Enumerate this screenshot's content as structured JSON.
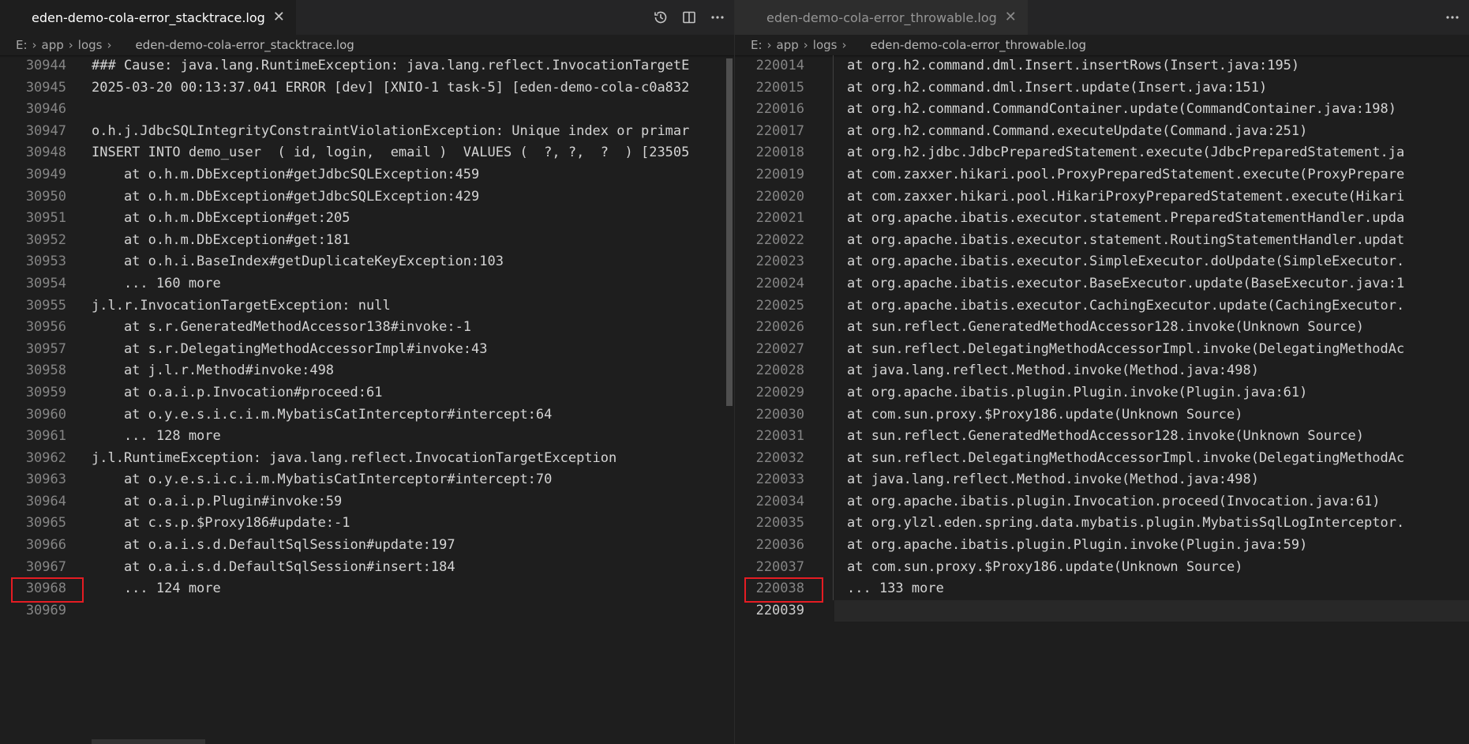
{
  "left": {
    "tab_label": "eden-demo-cola-error_stacktrace.log",
    "breadcrumbs": [
      "E:",
      "app",
      "logs"
    ],
    "breadcrumb_file": "eden-demo-cola-error_stacktrace.log",
    "line_numbers": [
      "30944",
      "30945",
      "30946",
      "30947",
      "30948",
      "30949",
      "30950",
      "30951",
      "30952",
      "30953",
      "30954",
      "30955",
      "30956",
      "30957",
      "30958",
      "30959",
      "30960",
      "30961",
      "30962",
      "30963",
      "30964",
      "30965",
      "30966",
      "30967",
      "30968",
      "30969"
    ],
    "lines": [
      "### Cause: java.lang.RuntimeException: java.lang.reflect.InvocationTargetE",
      "2025-03-20 00:13:37.041 ERROR [dev] [XNIO-1 task-5] [eden-demo-cola-c0a832",
      "",
      "o.h.j.JdbcSQLIntegrityConstraintViolationException: Unique index or primar",
      "INSERT INTO demo_user  ( id, login,  email )  VALUES (  ?, ?,  ?  ) [23505",
      "    at o.h.m.DbException#getJdbcSQLException:459",
      "    at o.h.m.DbException#getJdbcSQLException:429",
      "    at o.h.m.DbException#get:205",
      "    at o.h.m.DbException#get:181",
      "    at o.h.i.BaseIndex#getDuplicateKeyException:103",
      "    ... 160 more",
      "j.l.r.InvocationTargetException: null",
      "    at s.r.GeneratedMethodAccessor138#invoke:-1",
      "    at s.r.DelegatingMethodAccessorImpl#invoke:43",
      "    at j.l.r.Method#invoke:498",
      "    at o.a.i.p.Invocation#proceed:61",
      "    at o.y.e.s.i.c.i.m.MybatisCatInterceptor#intercept:64",
      "    ... 128 more",
      "j.l.RuntimeException: java.lang.reflect.InvocationTargetException",
      "    at o.y.e.s.i.c.i.m.MybatisCatInterceptor#intercept:70",
      "    at o.a.i.p.Plugin#invoke:59",
      "    at c.s.p.$Proxy186#update:-1",
      "    at o.a.i.s.d.DefaultSqlSession#update:197",
      "    at o.a.i.s.d.DefaultSqlSession#insert:184",
      "    ... 124 more",
      ""
    ],
    "highlighted_line": "30968",
    "icons": [
      "history-icon",
      "split-editor-icon",
      "more-actions-icon",
      "close-icon",
      "chevron-right-icon"
    ]
  },
  "right": {
    "tab_label": "eden-demo-cola-error_throwable.log",
    "breadcrumbs": [
      "E:",
      "app",
      "logs"
    ],
    "breadcrumb_file": "eden-demo-cola-error_throwable.log",
    "line_numbers": [
      "220014",
      "220015",
      "220016",
      "220017",
      "220018",
      "220019",
      "220020",
      "220021",
      "220022",
      "220023",
      "220024",
      "220025",
      "220026",
      "220027",
      "220028",
      "220029",
      "220030",
      "220031",
      "220032",
      "220033",
      "220034",
      "220035",
      "220036",
      "220037",
      "220038",
      "220039"
    ],
    "lines": [
      "at org.h2.command.dml.Insert.insertRows(Insert.java:195)",
      "at org.h2.command.dml.Insert.update(Insert.java:151)",
      "at org.h2.command.CommandContainer.update(CommandContainer.java:198)",
      "at org.h2.command.Command.executeUpdate(Command.java:251)",
      "at org.h2.jdbc.JdbcPreparedStatement.execute(JdbcPreparedStatement.ja",
      "at com.zaxxer.hikari.pool.ProxyPreparedStatement.execute(ProxyPrepare",
      "at com.zaxxer.hikari.pool.HikariProxyPreparedStatement.execute(Hikari",
      "at org.apache.ibatis.executor.statement.PreparedStatementHandler.upda",
      "at org.apache.ibatis.executor.statement.RoutingStatementHandler.updat",
      "at org.apache.ibatis.executor.SimpleExecutor.doUpdate(SimpleExecutor.",
      "at org.apache.ibatis.executor.BaseExecutor.update(BaseExecutor.java:1",
      "at org.apache.ibatis.executor.CachingExecutor.update(CachingExecutor.",
      "at sun.reflect.GeneratedMethodAccessor128.invoke(Unknown Source)",
      "at sun.reflect.DelegatingMethodAccessorImpl.invoke(DelegatingMethodAc",
      "at java.lang.reflect.Method.invoke(Method.java:498)",
      "at org.apache.ibatis.plugin.Plugin.invoke(Plugin.java:61)",
      "at com.sun.proxy.$Proxy186.update(Unknown Source)",
      "at sun.reflect.GeneratedMethodAccessor128.invoke(Unknown Source)",
      "at sun.reflect.DelegatingMethodAccessorImpl.invoke(DelegatingMethodAc",
      "at java.lang.reflect.Method.invoke(Method.java:498)",
      "at org.apache.ibatis.plugin.Invocation.proceed(Invocation.java:61)",
      "at org.ylzl.eden.spring.data.mybatis.plugin.MybatisSqlLogInterceptor.",
      "at org.apache.ibatis.plugin.Plugin.invoke(Plugin.java:59)",
      "at com.sun.proxy.$Proxy186.update(Unknown Source)",
      "... 133 more",
      ""
    ],
    "highlighted_line": "220038",
    "current_line": "220039",
    "icons": [
      "more-actions-icon",
      "close-icon",
      "chevron-right-icon"
    ]
  },
  "colors": {
    "editor_bg": "#1e1e1e",
    "tab_bar_bg": "#252526",
    "highlight_border": "#e51c23",
    "line_number": "#858585",
    "text": "#d4d4d4"
  }
}
